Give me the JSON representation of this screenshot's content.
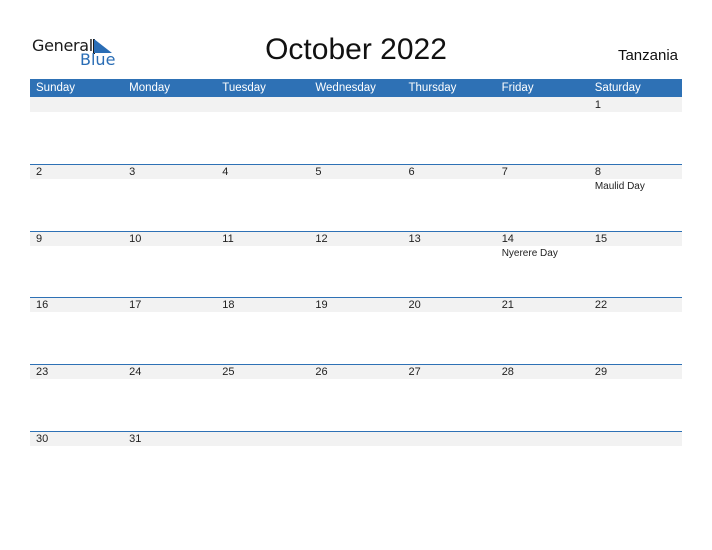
{
  "logo": {
    "text_general": "General",
    "text_blue": "Blue"
  },
  "title": "October 2022",
  "country": "Tanzania",
  "colors": {
    "accent": "#2e71b5",
    "strip": "#f2f2f2"
  },
  "weekdays": [
    "Sunday",
    "Monday",
    "Tuesday",
    "Wednesday",
    "Thursday",
    "Friday",
    "Saturday"
  ],
  "weeks": [
    [
      {
        "d": ""
      },
      {
        "d": ""
      },
      {
        "d": ""
      },
      {
        "d": ""
      },
      {
        "d": ""
      },
      {
        "d": ""
      },
      {
        "d": "1"
      }
    ],
    [
      {
        "d": "2"
      },
      {
        "d": "3"
      },
      {
        "d": "4"
      },
      {
        "d": "5"
      },
      {
        "d": "6"
      },
      {
        "d": "7"
      },
      {
        "d": "8",
        "h": "Maulid Day"
      }
    ],
    [
      {
        "d": "9"
      },
      {
        "d": "10"
      },
      {
        "d": "11"
      },
      {
        "d": "12"
      },
      {
        "d": "13"
      },
      {
        "d": "14",
        "h": "Nyerere Day"
      },
      {
        "d": "15"
      }
    ],
    [
      {
        "d": "16"
      },
      {
        "d": "17"
      },
      {
        "d": "18"
      },
      {
        "d": "19"
      },
      {
        "d": "20"
      },
      {
        "d": "21"
      },
      {
        "d": "22"
      }
    ],
    [
      {
        "d": "23"
      },
      {
        "d": "24"
      },
      {
        "d": "25"
      },
      {
        "d": "26"
      },
      {
        "d": "27"
      },
      {
        "d": "28"
      },
      {
        "d": "29"
      }
    ],
    [
      {
        "d": "30"
      },
      {
        "d": "31"
      },
      {
        "d": ""
      },
      {
        "d": ""
      },
      {
        "d": ""
      },
      {
        "d": ""
      },
      {
        "d": ""
      }
    ]
  ]
}
